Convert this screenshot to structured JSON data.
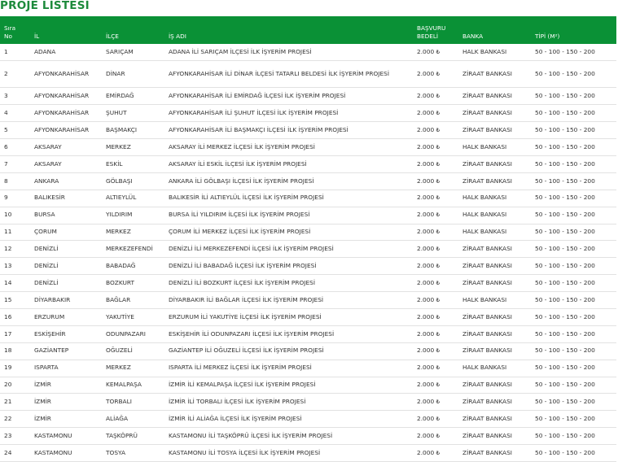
{
  "page": {
    "title": "PROJE LİSTESİ"
  },
  "table": {
    "headers": {
      "no_line1": "Sıra",
      "no_line2": "No",
      "il": "İL",
      "ilce": "İLÇE",
      "is_adi": "İŞ ADI",
      "basvuru_line1": "BAŞVURU",
      "basvuru_line2": "BEDELİ",
      "banka": "BANKA",
      "tipi": "TİPİ (M²)"
    },
    "rows": [
      {
        "no": "1",
        "il": "ADANA",
        "ilce": "SARIÇAM",
        "is_adi": "ADANA İLİ SARIÇAM İLÇESİ İLK İŞYERİM PROJESİ",
        "bedel": "2.000 ₺",
        "banka": "HALK BANKASI",
        "tipi": "50 - 100 - 150 - 200"
      },
      {
        "no": "2",
        "il": "AFYONKARAHİSAR",
        "ilce": "DİNAR",
        "is_adi": "AFYONKARAHİSAR İLİ DİNAR İLÇESİ TATARLI BELDESİ İLK İŞYERİM PROJESİ",
        "bedel": "2.000 ₺",
        "banka": "ZİRAAT BANKASI",
        "tipi": "50 - 100 - 150 - 200"
      },
      {
        "no": "3",
        "il": "AFYONKARAHİSAR",
        "ilce": "EMİRDAĞ",
        "is_adi": "AFYONKARAHİSAR İLİ EMİRDAĞ İLÇESİ İLK İŞYERİM PROJESİ",
        "bedel": "2.000 ₺",
        "banka": "ZİRAAT BANKASI",
        "tipi": "50 - 100 - 150 - 200"
      },
      {
        "no": "4",
        "il": "AFYONKARAHİSAR",
        "ilce": "ŞUHUT",
        "is_adi": "AFYONKARAHİSAR İLİ ŞUHUT İLÇESİ İLK İŞYERİM PROJESİ",
        "bedel": "2.000 ₺",
        "banka": "ZİRAAT BANKASI",
        "tipi": "50 - 100 - 150 - 200"
      },
      {
        "no": "5",
        "il": "AFYONKARAHİSAR",
        "ilce": "BAŞMAKÇI",
        "is_adi": "AFYONKARAHİSAR İLİ BAŞMAKÇI İLÇESİ İLK İŞYERİM PROJESİ",
        "bedel": "2.000 ₺",
        "banka": "ZİRAAT BANKASI",
        "tipi": "50 - 100 - 150 - 200"
      },
      {
        "no": "6",
        "il": "AKSARAY",
        "ilce": "MERKEZ",
        "is_adi": "AKSARAY İLİ MERKEZ İLÇESİ İLK İŞYERİM PROJESİ",
        "bedel": "2.000 ₺",
        "banka": "HALK BANKASI",
        "tipi": "50 - 100 - 150 - 200"
      },
      {
        "no": "7",
        "il": "AKSARAY",
        "ilce": "ESKİL",
        "is_adi": "AKSARAY İLİ ESKİL İLÇESİ İLK İŞYERİM PROJESİ",
        "bedel": "2.000 ₺",
        "banka": "ZİRAAT BANKASI",
        "tipi": "50 - 100 - 150 - 200"
      },
      {
        "no": "8",
        "il": "ANKARA",
        "ilce": "GÖLBAŞI",
        "is_adi": "ANKARA İLİ GÖLBAŞI İLÇESİ İLK İŞYERİM PROJESİ",
        "bedel": "2.000 ₺",
        "banka": "ZİRAAT BANKASI",
        "tipi": "50 - 100 - 150 - 200"
      },
      {
        "no": "9",
        "il": "BALIKESİR",
        "ilce": "ALTIEYLÜL",
        "is_adi": "BALIKESİR İLİ ALTIEYLÜL İLÇESİ İLK İŞYERİM PROJESİ",
        "bedel": "2.000 ₺",
        "banka": "HALK BANKASI",
        "tipi": "50 - 100 - 150 - 200"
      },
      {
        "no": "10",
        "il": "BURSA",
        "ilce": "YILDIRIM",
        "is_adi": "BURSA İLİ YILDIRIM İLÇESİ İLK İŞYERİM PROJESİ",
        "bedel": "2.000 ₺",
        "banka": "HALK BANKASI",
        "tipi": "50 - 100 - 150 - 200"
      },
      {
        "no": "11",
        "il": "ÇORUM",
        "ilce": "MERKEZ",
        "is_adi": "ÇORUM İLİ MERKEZ İLÇESİ İLK İŞYERİM PROJESİ",
        "bedel": "2.000 ₺",
        "banka": "HALK BANKASI",
        "tipi": "50 - 100 - 150 - 200"
      },
      {
        "no": "12",
        "il": "DENİZLİ",
        "ilce": "MERKEZEFENDİ",
        "is_adi": "DENİZLİ İLİ MERKEZEFENDİ İLÇESİ İLK İŞYERİM PROJESİ",
        "bedel": "2.000 ₺",
        "banka": "ZİRAAT BANKASI",
        "tipi": "50 - 100 - 150 - 200"
      },
      {
        "no": "13",
        "il": "DENİZLİ",
        "ilce": "BABADAĞ",
        "is_adi": "DENİZLİ İLİ BABADAĞ İLÇESİ İLK İŞYERİM PROJESİ",
        "bedel": "2.000 ₺",
        "banka": "ZİRAAT BANKASI",
        "tipi": "50 - 100 - 150 - 200"
      },
      {
        "no": "14",
        "il": "DENİZLİ",
        "ilce": "BOZKURT",
        "is_adi": "DENİZLİ İLİ BOZKURT İLÇESİ İLK İŞYERİM PROJESİ",
        "bedel": "2.000 ₺",
        "banka": "ZİRAAT BANKASI",
        "tipi": "50 - 100 - 150 - 200"
      },
      {
        "no": "15",
        "il": "DİYARBAKIR",
        "ilce": "BAĞLAR",
        "is_adi": "DİYARBAKIR İLİ BAĞLAR İLÇESİ İLK İŞYERİM PROJESİ",
        "bedel": "2.000 ₺",
        "banka": "HALK BANKASI",
        "tipi": "50 - 100 - 150 - 200"
      },
      {
        "no": "16",
        "il": "ERZURUM",
        "ilce": "YAKUTİYE",
        "is_adi": "ERZURUM İLİ YAKUTİYE İLÇESİ İLK İŞYERİM PROJESİ",
        "bedel": "2.000 ₺",
        "banka": "ZİRAAT BANKASI",
        "tipi": "50 - 100 - 150 - 200"
      },
      {
        "no": "17",
        "il": "ESKİŞEHİR",
        "ilce": "ODUNPAZARI",
        "is_adi": "ESKİŞEHİR İLİ ODUNPAZARI İLÇESİ İLK İŞYERİM PROJESİ",
        "bedel": "2.000 ₺",
        "banka": "ZİRAAT BANKASI",
        "tipi": "50 - 100 - 150 - 200"
      },
      {
        "no": "18",
        "il": "GAZİANTEP",
        "ilce": "OĞUZELİ",
        "is_adi": "GAZİANTEP İLİ OĞUZELİ İLÇESİ İLK İŞYERİM PROJESİ",
        "bedel": "2.000 ₺",
        "banka": "ZİRAAT BANKASI",
        "tipi": "50 - 100 - 150 - 200"
      },
      {
        "no": "19",
        "il": "ISPARTA",
        "ilce": "MERKEZ",
        "is_adi": "ISPARTA İLİ MERKEZ İLÇESİ İLK İŞYERİM PROJESİ",
        "bedel": "2.000 ₺",
        "banka": "HALK BANKASI",
        "tipi": "50 - 100 - 150 - 200"
      },
      {
        "no": "20",
        "il": "İZMİR",
        "ilce": "KEMALPAŞA",
        "is_adi": "İZMİR İLİ KEMALPAŞA İLÇESİ İLK İŞYERİM PROJESİ",
        "bedel": "2.000 ₺",
        "banka": "ZİRAAT BANKASI",
        "tipi": "50 - 100 - 150 - 200"
      },
      {
        "no": "21",
        "il": "İZMİR",
        "ilce": "TORBALI",
        "is_adi": "İZMİR İLİ TORBALI İLÇESİ İLK İŞYERİM PROJESİ",
        "bedel": "2.000 ₺",
        "banka": "ZİRAAT BANKASI",
        "tipi": "50 - 100 - 150 - 200"
      },
      {
        "no": "22",
        "il": "İZMİR",
        "ilce": "ALİAĞA",
        "is_adi": "İZMİR İLİ ALİAĞA İLÇESİ İLK İŞYERİM PROJESİ",
        "bedel": "2.000 ₺",
        "banka": "ZİRAAT BANKASI",
        "tipi": "50 - 100 - 150 - 200"
      },
      {
        "no": "23",
        "il": "KASTAMONU",
        "ilce": "TAŞKÖPRÜ",
        "is_adi": "KASTAMONU İLİ TAŞKÖPRÜ İLÇESİ İLK İŞYERİM PROJESİ",
        "bedel": "2.000 ₺",
        "banka": "ZİRAAT BANKASI",
        "tipi": "50 - 100 - 150 - 200"
      },
      {
        "no": "24",
        "il": "KASTAMONU",
        "ilce": "TOSYA",
        "is_adi": "KASTAMONU İLİ TOSYA İLÇESİ İLK İŞYERİM PROJESİ",
        "bedel": "2.000 ₺",
        "banka": "ZİRAAT BANKASI",
        "tipi": "50 - 100 - 150 - 200"
      }
    ]
  },
  "colors": {
    "accent": "#0a9136",
    "title": "#1d8a3b"
  }
}
